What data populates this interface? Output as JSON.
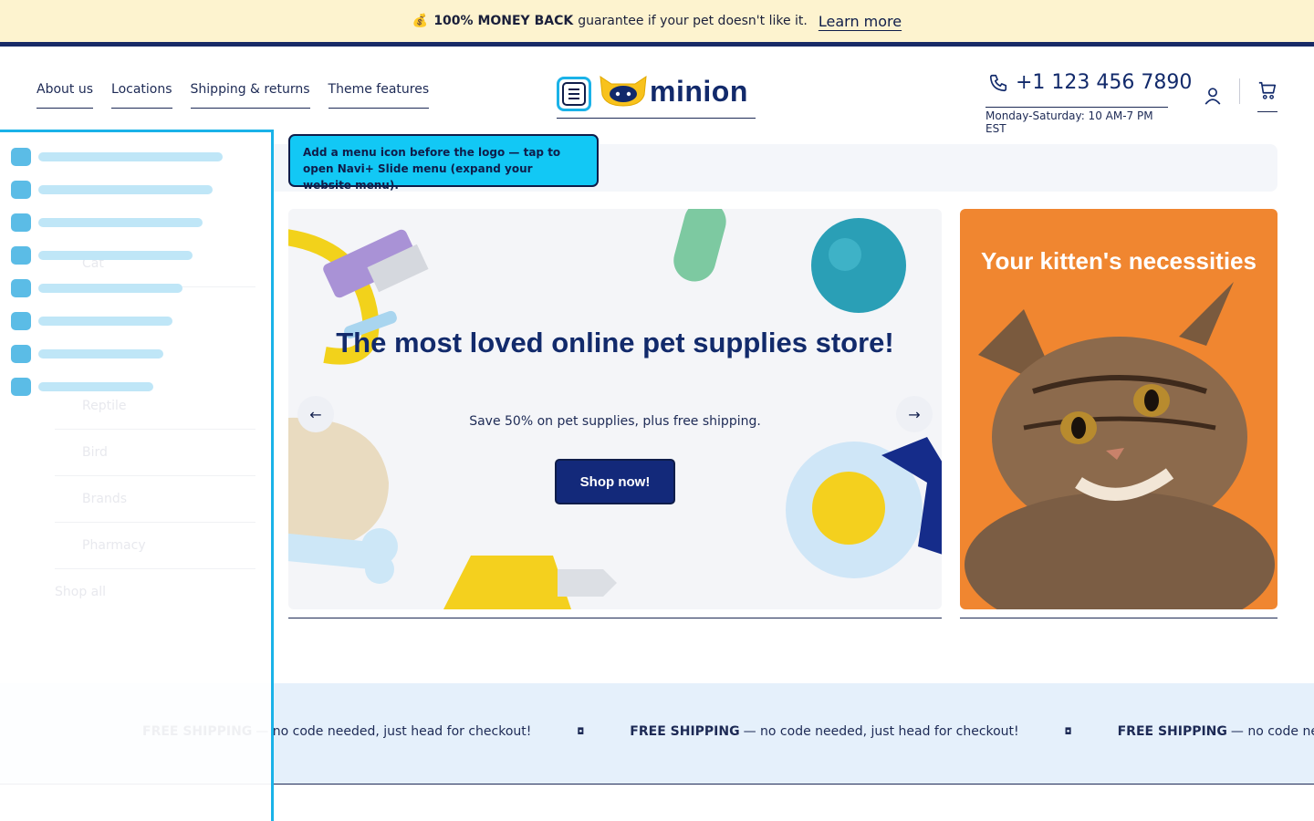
{
  "announcement": {
    "icon": "money-bag-icon",
    "bold": "100% MONEY BACK",
    "text": "guarantee if your pet doesn't like it.",
    "link": "Learn more"
  },
  "header": {
    "nav": [
      "About us",
      "Locations",
      "Shipping & returns",
      "Theme features"
    ],
    "logo_text": "minion",
    "phone": "+1 123 456 7890",
    "hours": "Monday-Saturday: 10 AM-7 PM EST"
  },
  "tooltip": {
    "text": "Add a menu icon before the logo — tap to open Navi+ Slide menu (expand your website menu)."
  },
  "sidebar": {
    "ghost_items": [
      "Cat",
      "",
      "",
      "Reptile",
      "Bird",
      "Brands",
      "Pharmacy"
    ],
    "ghost_link": "Shop all"
  },
  "hero": {
    "title": "The most loved online pet supplies store!",
    "subtitle": "Save 50% on pet supplies, plus free shipping.",
    "cta": "Shop now!",
    "prev": "←",
    "next": "→"
  },
  "promo": {
    "title": "Your kitten's necessities"
  },
  "marquee": {
    "bold": "FREE SHIPPING",
    "text": "— no code needed, just head for checkout!"
  },
  "colors": {
    "announcement_bg": "#fdf3cf",
    "brand_navy": "#13297a",
    "accent_cyan": "#12c8f5",
    "promo_orange": "#f08630",
    "marquee_bg": "#e5f0fb"
  }
}
